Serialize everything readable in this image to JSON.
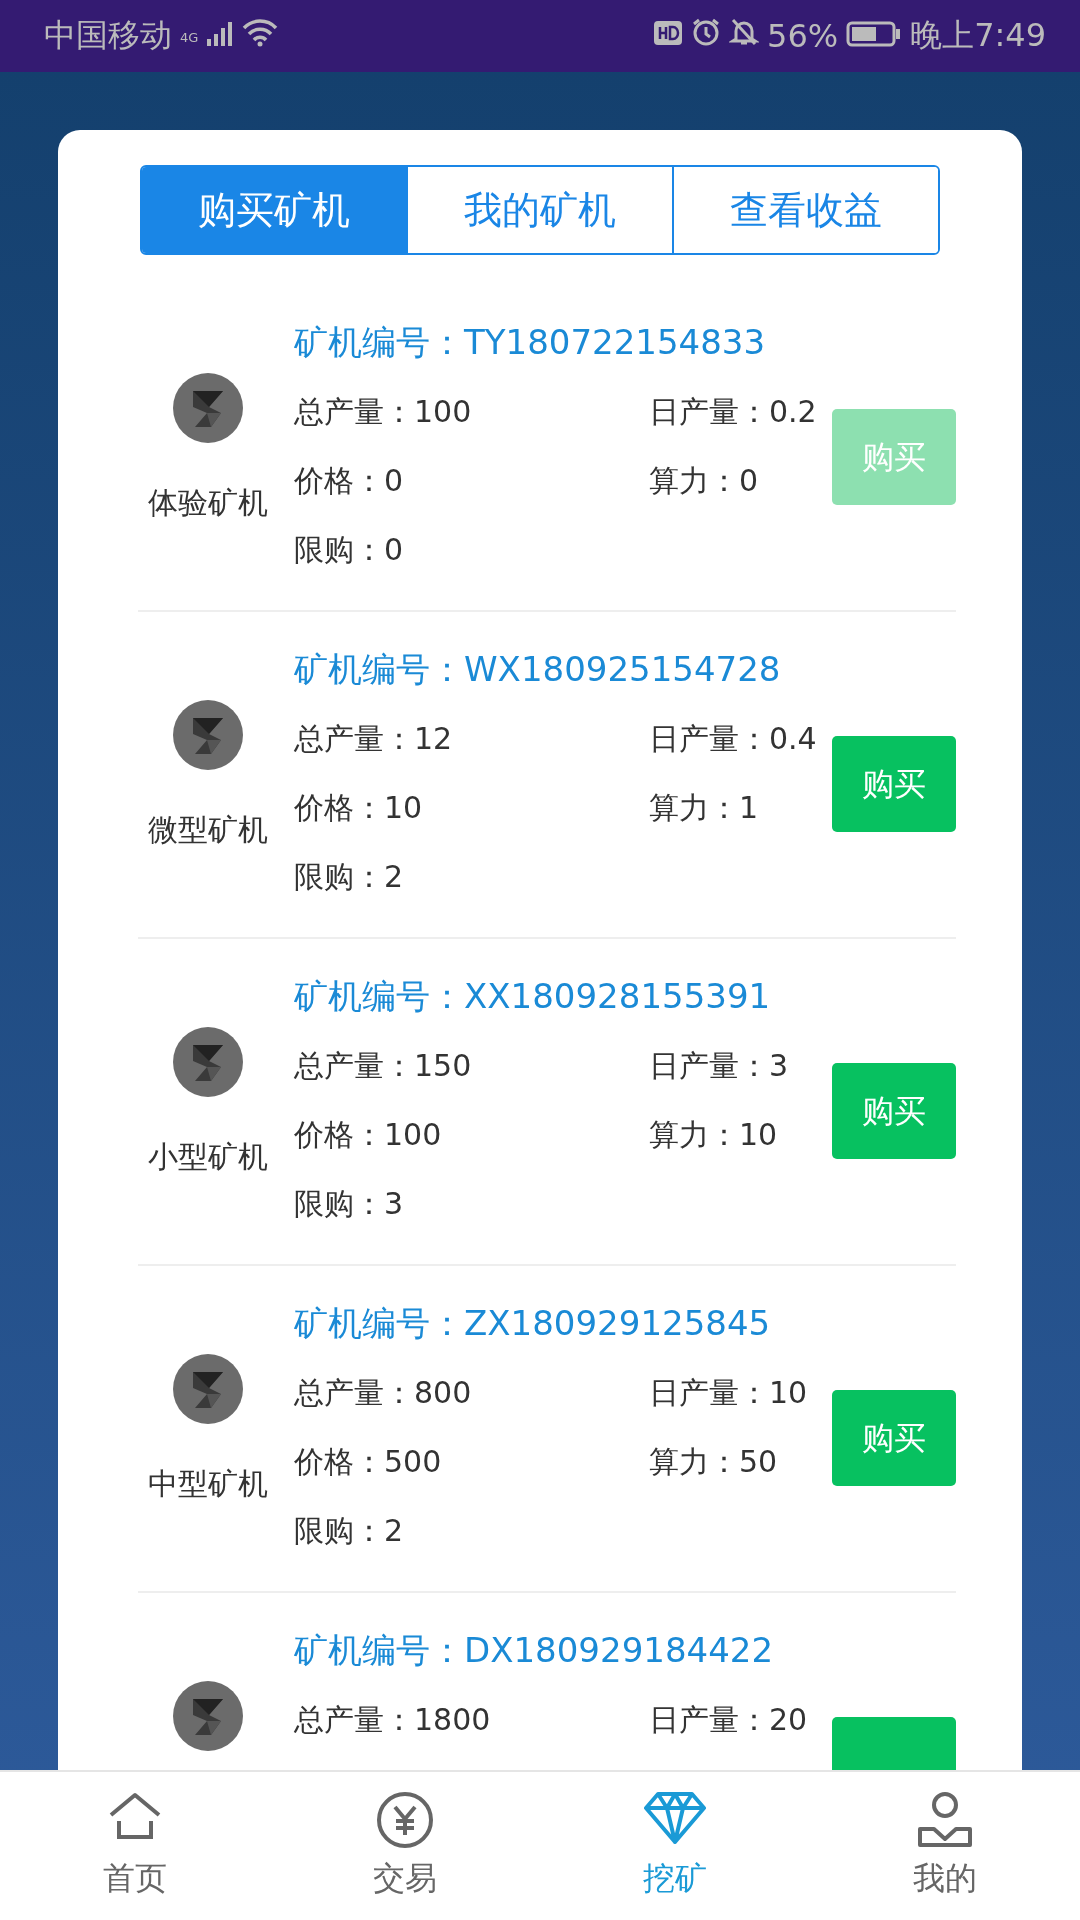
{
  "status_bar": {
    "carrier": "中国移动",
    "network": "4G",
    "battery": "56%",
    "time": "晚上7:49"
  },
  "tabs": [
    {
      "label": "购买矿机",
      "selected": true
    },
    {
      "label": "我的矿机",
      "selected": false
    },
    {
      "label": "查看收益",
      "selected": false
    }
  ],
  "miners": [
    {
      "name": "体验矿机",
      "code": "矿机编号：TY180722154833",
      "total": "总产量：100",
      "daily": "日产量：0.2",
      "price": "价格：0",
      "power": "算力：0",
      "limit": "限购：0",
      "button": {
        "label": "购买",
        "disabled": true
      }
    },
    {
      "name": "微型矿机",
      "code": "矿机编号：WX180925154728",
      "total": "总产量：12",
      "daily": "日产量：0.4",
      "price": "价格：10",
      "power": "算力：1",
      "limit": "限购：2",
      "button": {
        "label": "购买",
        "disabled": false
      }
    },
    {
      "name": "小型矿机",
      "code": "矿机编号：XX180928155391",
      "total": "总产量：150",
      "daily": "日产量：3",
      "price": "价格：100",
      "power": "算力：10",
      "limit": "限购：3",
      "button": {
        "label": "购买",
        "disabled": false
      }
    },
    {
      "name": "中型矿机",
      "code": "矿机编号：ZX180929125845",
      "total": "总产量：800",
      "daily": "日产量：10",
      "price": "价格：500",
      "power": "算力：50",
      "limit": "限购：2",
      "button": {
        "label": "购买",
        "disabled": false
      }
    },
    {
      "code": "矿机编号：DX180929184422",
      "total": "总产量：1800",
      "daily": "日产量：20",
      "button": {
        "disabled": false
      }
    }
  ],
  "nav": [
    {
      "kind": "home",
      "label": "首页",
      "selected": false
    },
    {
      "kind": "trade",
      "label": "交易",
      "selected": false
    },
    {
      "kind": "mining",
      "label": "挖矿",
      "selected": true
    },
    {
      "kind": "profile",
      "label": "我的",
      "selected": false
    }
  ]
}
